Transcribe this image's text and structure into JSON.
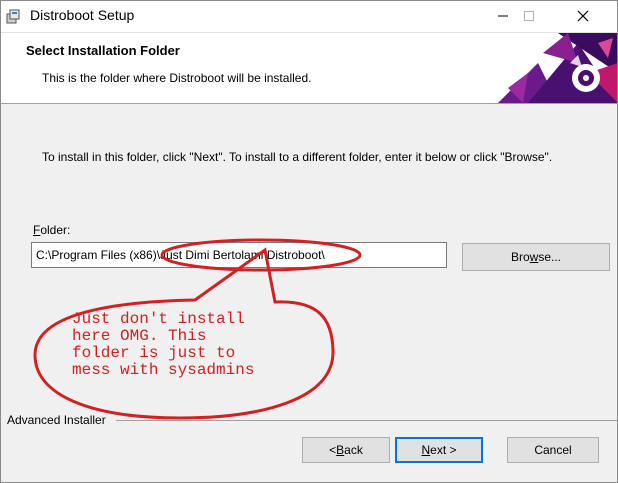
{
  "window": {
    "title": "Distroboot Setup",
    "minimize_icon": "minimize-icon",
    "maximize_icon": "maximize-icon",
    "close_icon": "close-icon"
  },
  "header": {
    "title": "Select Installation Folder",
    "subtitle": "This is the folder where Distroboot will be installed."
  },
  "body": {
    "instructions": "To install in this folder, click \"Next\". To install to a different folder, enter it below or click \"Browse\".",
    "folder_label_accel": "F",
    "folder_label_rest": "older:",
    "folder_value": "C:\\Program Files (x86)\\Just Dimi Bertolami\\Distroboot\\",
    "browse_accel": "w",
    "browse_pre": "Bro",
    "browse_post": "se..."
  },
  "annotation": {
    "text": "Just don't install\nhere OMG. This\nfolder is just to\nmess with sysadmins",
    "color": "#d42020"
  },
  "footer": {
    "brand": "Advanced Installer",
    "back_pre": "< ",
    "back_accel": "B",
    "back_post": "ack",
    "next_accel": "N",
    "next_post": "ext >",
    "cancel": "Cancel"
  },
  "colors": {
    "accent": "#0078d7",
    "annotation_red": "#d42020",
    "header_art_purple": "#4a1070",
    "header_art_magenta": "#c0186a"
  }
}
